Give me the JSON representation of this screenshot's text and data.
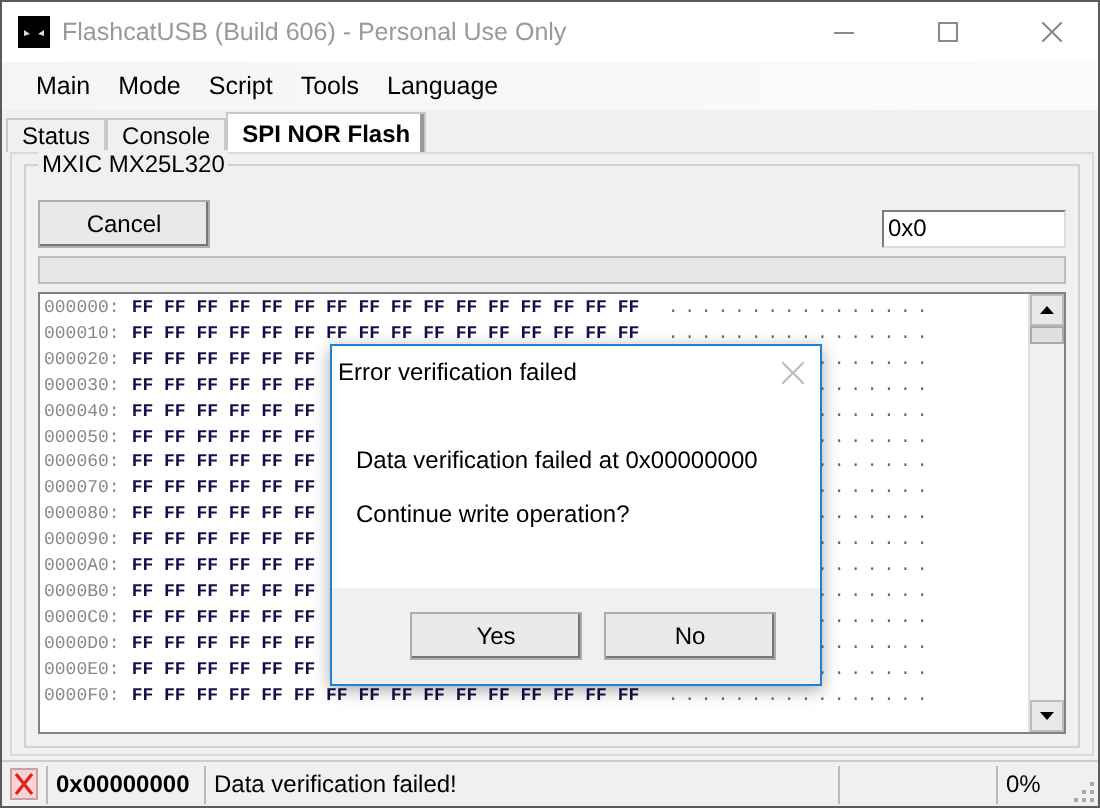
{
  "window": {
    "title": "FlashcatUSB (Build 606) - Personal Use Only"
  },
  "menu": [
    "Main",
    "Mode",
    "Script",
    "Tools",
    "Language"
  ],
  "tabs": [
    {
      "label": "Status",
      "selected": false
    },
    {
      "label": "Console",
      "selected": false
    },
    {
      "label": "SPI NOR Flash",
      "selected": true
    }
  ],
  "group": {
    "title": "MXIC MX25L320",
    "cancel_button": "Cancel",
    "address_field": "0x0",
    "progress": {
      "level": 0
    }
  },
  "hex_rows": [
    {
      "address": "000000:",
      "bytes": "FF FF FF FF FF FF FF FF FF FF FF FF FF FF FF FF",
      "ascii": "................"
    },
    {
      "address": "000010:",
      "bytes": "FF FF FF FF FF FF FF FF FF FF FF FF FF FF FF FF",
      "ascii": "................"
    },
    {
      "address": "000020:",
      "bytes": "FF FF FF FF FF FF",
      "ascii": "......."
    },
    {
      "address": "000030:",
      "bytes": "FF FF FF FF FF FF",
      "ascii": "......."
    },
    {
      "address": "000040:",
      "bytes": "FF FF FF FF FF FF",
      "ascii": "......."
    },
    {
      "address": "000050:",
      "bytes": "FF FF FF FF FF FF",
      "ascii": "......."
    },
    {
      "address": "000060:",
      "bytes": "FF FF FF FF FF FF",
      "ascii": "......."
    },
    {
      "address": "000070:",
      "bytes": "FF FF FF FF FF FF",
      "ascii": "......."
    },
    {
      "address": "000080:",
      "bytes": "FF FF FF FF FF FF",
      "ascii": "......."
    },
    {
      "address": "000090:",
      "bytes": "FF FF FF FF FF FF",
      "ascii": "......."
    },
    {
      "address": "0000A0:",
      "bytes": "FF FF FF FF FF FF",
      "ascii": "......."
    },
    {
      "address": "0000B0:",
      "bytes": "FF FF FF FF FF FF",
      "ascii": "......."
    },
    {
      "address": "0000C0:",
      "bytes": "FF FF FF FF FF FF",
      "ascii": "......."
    },
    {
      "address": "0000D0:",
      "bytes": "FF FF FF FF FF FF",
      "ascii": "......."
    },
    {
      "address": "0000E0:",
      "bytes": "FF FF FF FF FF FF",
      "ascii": "......."
    },
    {
      "address": "0000F0:",
      "bytes": "FF FF FF FF FF FF FF FF FF FF FF FF FF FF FF FF",
      "ascii": "................"
    }
  ],
  "dialog": {
    "title": "Error verification failed",
    "message": "Data verification failed at 0x00000000",
    "question": "Continue write operation?",
    "buttons": [
      "Yes",
      "No"
    ]
  },
  "status_bar": {
    "address": "0x00000000",
    "message": "Data verification failed!",
    "percent": "0%"
  }
}
